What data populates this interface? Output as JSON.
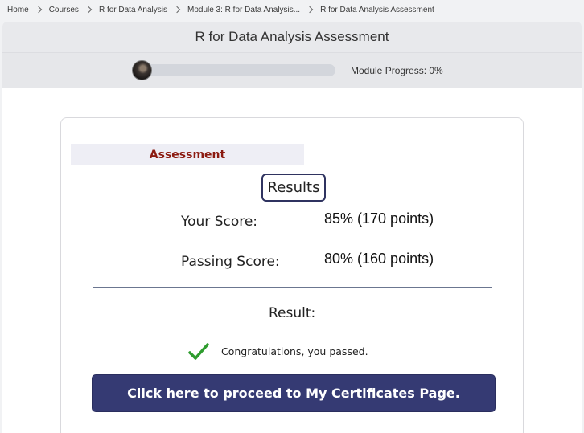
{
  "breadcrumb": {
    "items": [
      "Home",
      "Courses",
      "R for Data Analysis",
      "Module 3: R for Data Analysis...",
      "R for Data Analysis Assessment"
    ]
  },
  "header": {
    "title": "R for Data Analysis Assessment",
    "progress_label": "Module Progress: 0%",
    "progress_value": 0
  },
  "assessment": {
    "heading": "Assessment",
    "results_label": "Results",
    "your_score_label": "Your Score:",
    "your_score_value": "85% (170 points)",
    "passing_score_label": "Passing Score:",
    "passing_score_value": "80% (160 points)",
    "result_label": "Result:",
    "result_message": "Congratulations, you passed.",
    "cta_label": "Click here to proceed to My Certificates Page."
  },
  "colors": {
    "heading": "#8b1a10",
    "cta_background": "#353a73",
    "check": "#2e9c2e"
  },
  "icons": {
    "separator": "chevron-right-icon",
    "passed": "checkmark-icon"
  }
}
